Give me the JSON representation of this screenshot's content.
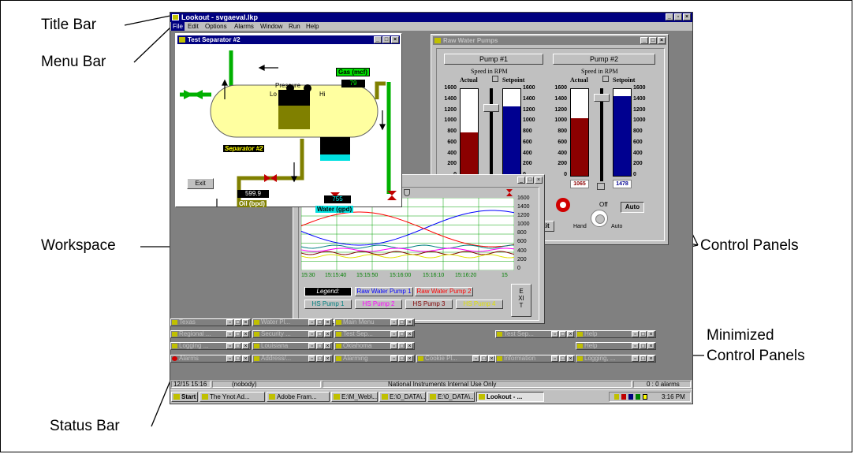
{
  "callouts": {
    "title_bar": "Title Bar",
    "menu_bar": "Menu Bar",
    "workspace": "Workspace",
    "status_bar": "Status Bar",
    "control_panels": "Control Panels",
    "minimized_line1": "Minimized",
    "minimized_line2": "Control Panels"
  },
  "app": {
    "title": "Lookout - svgaeval.lkp",
    "menu": [
      "File",
      "Edit",
      "Options",
      "Alarms",
      "Window",
      "Run",
      "Help"
    ]
  },
  "separator": {
    "title": "Test Separator #2",
    "gas_label": "Gas (mcf)",
    "gas_value": "79",
    "pressure_label": "Pressure",
    "lo": "Lo",
    "hi": "Hi",
    "tank_label": "Separator #2",
    "exit": "Exit",
    "oil_value": "599.9",
    "oil_label": "Oil (bpd)",
    "water_value": "755",
    "water_label": "Water (gpd)"
  },
  "pumps": {
    "title": "Raw Water Pumps",
    "pump1": {
      "name": "Pump #1",
      "speed": "Speed in RPM",
      "actual": "Actual",
      "setpoint": "Setpoint",
      "actual_frac": 0.5,
      "setpoint_frac": 0.8
    },
    "pump2": {
      "name": "Pump #2",
      "speed": "Speed in RPM",
      "actual": "Actual",
      "setpoint": "Setpoint",
      "actual_value": "1065",
      "setpoint_value": "1478",
      "actual_frac": 0.665,
      "setpoint_frac": 0.92
    },
    "scale": [
      "1600",
      "1400",
      "1200",
      "1000",
      "800",
      "600",
      "400",
      "200",
      "0"
    ],
    "off": "Off",
    "hand": "Hand",
    "auto_switch": "Auto",
    "auto_btn": "Auto",
    "exit_partial": "xit"
  },
  "trend": {
    "scale": [
      "1600",
      "1400",
      "1200",
      "1000",
      "800",
      "600",
      "400",
      "200",
      "0"
    ],
    "times": [
      "15:30",
      "15:15:40",
      "15:15:50",
      "15:16:00",
      "15:16:10",
      "15:16:20",
      "15"
    ],
    "legend_label": "Legend:",
    "series": [
      {
        "name": "Raw Water Pump 1",
        "color": "#0000ff"
      },
      {
        "name": "Raw Water Pump 2",
        "color": "#ff0000"
      },
      {
        "name": "HS Pump 1",
        "color": "#008080"
      },
      {
        "name": "HS Pump 2",
        "color": "#ff00ff"
      },
      {
        "name": "HS Pump 3",
        "color": "#800000"
      },
      {
        "name": "HS Pump 4",
        "color": "#e0e000"
      }
    ],
    "exit": "EXIT"
  },
  "minimized": [
    "Texas",
    "Water Pl...",
    "Main Menu",
    "Regional ...",
    "Security ...",
    "Test Sep...",
    "Logging ...",
    "Louisiana",
    "Oklahoma",
    "Alarms",
    "Address/...",
    "Alarming",
    "Cookie Pl...",
    "Information",
    "Logging, ...",
    "Test Sep...",
    "Help",
    "Help"
  ],
  "status": {
    "datetime": "12/15 15:16",
    "user": "(nobody)",
    "message": "National Instruments Internal Use Only",
    "alarms": "0 : 0 alarms"
  },
  "taskbar": {
    "start": "Start",
    "tasks": [
      "The Ynot Ad...",
      "Adobe Fram...",
      "E:\\M_Web\\...",
      "E:\\0_DATA\\...",
      "E:\\0_DATA\\...",
      "Lookout - ..."
    ],
    "clock": "3:16 PM"
  }
}
